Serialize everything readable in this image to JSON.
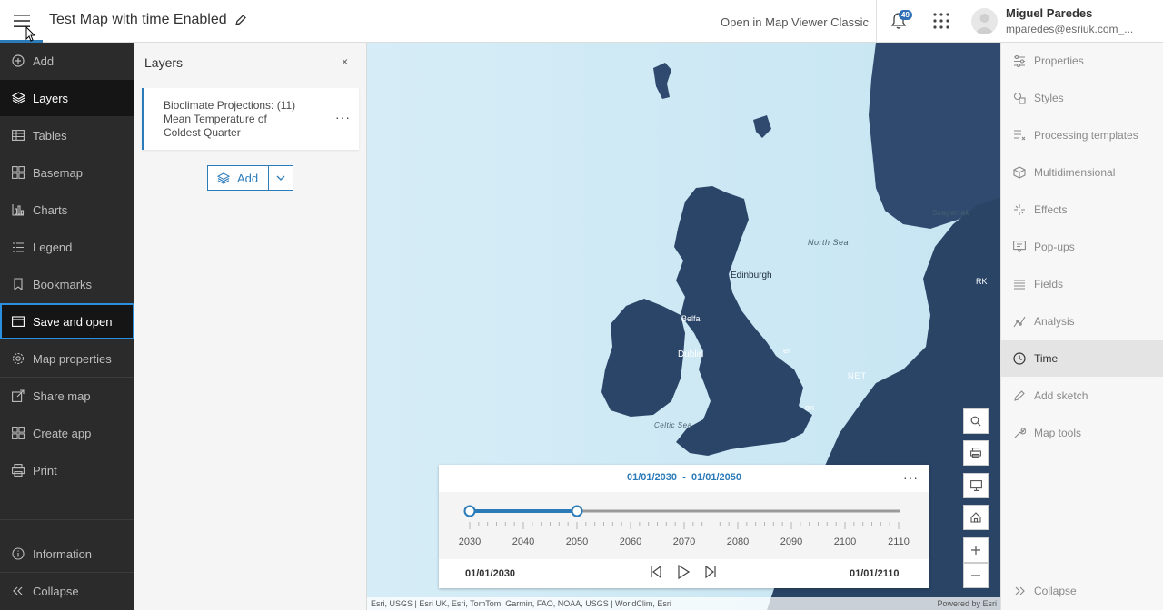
{
  "header": {
    "title": "Test Map with time Enabled",
    "open_classic": "Open in Map Viewer Classic",
    "notification_count": "49",
    "user_name": "Miguel Paredes",
    "user_email": "mparedes@esriuk.com_..."
  },
  "left_nav": {
    "items": [
      {
        "label": "Add",
        "icon": "plus-circle-icon"
      },
      {
        "label": "Layers",
        "icon": "layers-icon"
      },
      {
        "label": "Tables",
        "icon": "table-icon"
      },
      {
        "label": "Basemap",
        "icon": "basemap-icon"
      },
      {
        "label": "Charts",
        "icon": "chart-icon"
      },
      {
        "label": "Legend",
        "icon": "legend-icon"
      },
      {
        "label": "Bookmarks",
        "icon": "bookmark-icon"
      },
      {
        "label": "Save and open",
        "icon": "folder-icon"
      },
      {
        "label": "Map properties",
        "icon": "gear-icon"
      },
      {
        "label": "Share map",
        "icon": "share-icon"
      },
      {
        "label": "Create app",
        "icon": "grid-icon"
      },
      {
        "label": "Print",
        "icon": "print-icon"
      }
    ],
    "information": "Information",
    "collapse": "Collapse"
  },
  "layers_panel": {
    "title": "Layers",
    "close": "×",
    "layer_name": "Bioclimate Projections: (11) Mean Temperature of Coldest Quarter",
    "add_label": "Add"
  },
  "map": {
    "labels": {
      "north_sea": "North Sea",
      "skagerrak": "Skagerrak",
      "celtic_sea": "Celtic Sea",
      "edinburgh": "Edinburgh",
      "dublin": "Dublin",
      "belfast": "Belfa",
      "manchester": "er",
      "london": "on",
      "netherlands": "NET",
      "denmark": "RK"
    },
    "attribution": "Esri, USGS | Esri UK, Esri, TomTom, Garmin, FAO, NOAA, USGS | WorldClim, Esri",
    "powered_by": "Powered by Esri"
  },
  "time_slider": {
    "range_start": "01/01/2030",
    "range_sep": "-",
    "range_end": "01/01/2050",
    "ticks": [
      "2030",
      "2040",
      "2050",
      "2060",
      "2070",
      "2080",
      "2090",
      "2100",
      "2110"
    ],
    "start_label": "01/01/2030",
    "end_label": "01/01/2110",
    "thumb_start": 0,
    "thumb_end": 0.25
  },
  "right_nav": {
    "items": [
      {
        "label": "Properties",
        "icon": "sliders-icon"
      },
      {
        "label": "Styles",
        "icon": "styles-icon"
      },
      {
        "label": "Processing templates",
        "icon": "processing-icon"
      },
      {
        "label": "Multidimensional",
        "icon": "cube-icon"
      },
      {
        "label": "Effects",
        "icon": "sparkle-icon"
      },
      {
        "label": "Pop-ups",
        "icon": "popup-icon"
      },
      {
        "label": "Fields",
        "icon": "fields-icon"
      },
      {
        "label": "Analysis",
        "icon": "analysis-icon"
      },
      {
        "label": "Time",
        "icon": "clock-icon"
      },
      {
        "label": "Add sketch",
        "icon": "pencil-icon"
      },
      {
        "label": "Map tools",
        "icon": "wrench-icon"
      }
    ],
    "collapse": "Collapse"
  }
}
